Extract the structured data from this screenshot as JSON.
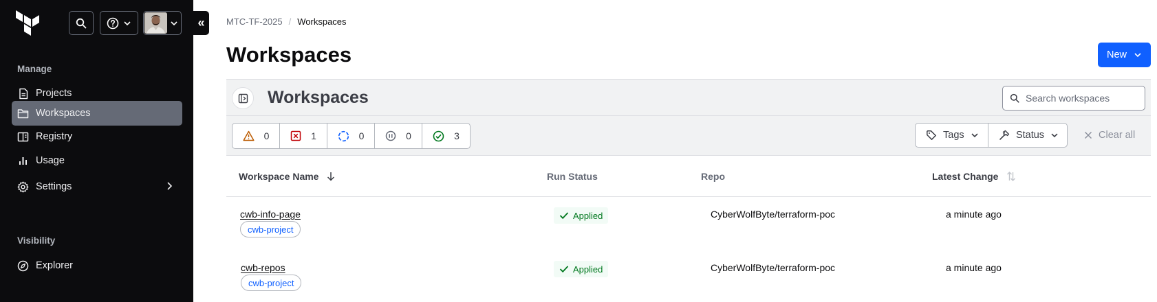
{
  "app": {
    "logo_icon": "terraform-logo-icon",
    "collapse_label": "«"
  },
  "sidebar": {
    "sections": [
      {
        "title": "Manage",
        "items": [
          {
            "label": "Projects",
            "icon": "file-text-icon"
          },
          {
            "label": "Workspaces",
            "icon": "folder-icon",
            "active": true
          },
          {
            "label": "Registry",
            "icon": "registry-icon"
          },
          {
            "label": "Usage",
            "icon": "bar-chart-icon"
          },
          {
            "label": "Settings",
            "icon": "gear-icon",
            "has_submenu": true
          }
        ]
      },
      {
        "title": "Visibility",
        "items": [
          {
            "label": "Explorer",
            "icon": "compass-icon"
          }
        ]
      }
    ]
  },
  "breadcrumb": {
    "organization": "MTC-TF-2025",
    "separator": "/",
    "current": "Workspaces"
  },
  "page": {
    "title": "Workspaces",
    "new_button": "New"
  },
  "panel": {
    "title": "Workspaces",
    "search_placeholder": "Search workspaces"
  },
  "status_filters": [
    {
      "icon": "warning-icon",
      "count": "0",
      "color": "#bb5a00"
    },
    {
      "icon": "error-icon",
      "count": "1",
      "color": "#c00005"
    },
    {
      "icon": "running-icon",
      "count": "0",
      "color": "#1060ff"
    },
    {
      "icon": "pause-icon",
      "count": "0",
      "color": "#656a76"
    },
    {
      "icon": "check-circle-icon",
      "count": "3",
      "color": "#00781e"
    }
  ],
  "filters": {
    "tags_label": "Tags",
    "status_label": "Status",
    "clear_label": "Clear all"
  },
  "table": {
    "columns": [
      "Workspace Name",
      "Run Status",
      "Repo",
      "Latest Change"
    ],
    "rows": [
      {
        "name": "cwb-info-page",
        "project": "cwb-project",
        "run_status": "Applied",
        "repo": "CyberWolfByte/terraform-poc",
        "latest_change": "a minute ago"
      },
      {
        "name": "cwb-repos",
        "project": "cwb-project",
        "run_status": "Applied",
        "repo": "CyberWolfByte/terraform-poc",
        "latest_change": "a minute ago"
      }
    ]
  },
  "colors": {
    "sidebar_bg": "#0c0c0e",
    "active_item_bg": "#656a76",
    "primary_blue": "#1060ff",
    "success_green": "#00781e"
  }
}
